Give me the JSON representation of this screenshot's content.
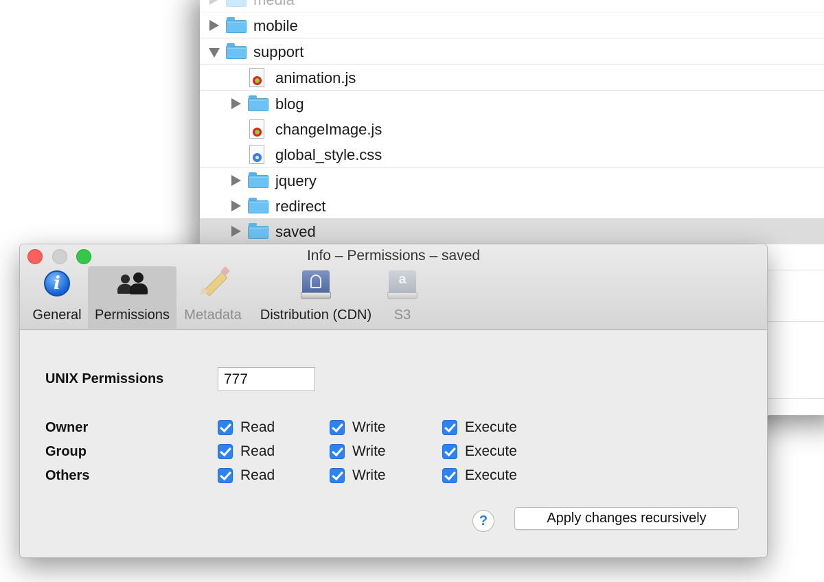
{
  "browser": {
    "rows": [
      {
        "label": "media",
        "kind": "folder",
        "expanded": false,
        "depth": 0,
        "faded": true
      },
      {
        "label": "mobile",
        "kind": "folder",
        "expanded": false,
        "depth": 0
      },
      {
        "label": "support",
        "kind": "folder",
        "expanded": true,
        "depth": 0
      },
      {
        "label": "animation.js",
        "kind": "js-file",
        "depth": 1
      },
      {
        "label": "blog",
        "kind": "folder",
        "expanded": false,
        "depth": 1
      },
      {
        "label": "changeImage.js",
        "kind": "js-file",
        "depth": 1
      },
      {
        "label": "global_style.css",
        "kind": "css-file",
        "depth": 1
      },
      {
        "label": "jquery",
        "kind": "folder",
        "expanded": false,
        "depth": 1
      },
      {
        "label": "redirect",
        "kind": "folder",
        "expanded": false,
        "depth": 1
      },
      {
        "label": "saved",
        "kind": "folder",
        "expanded": false,
        "depth": 1,
        "selected": true
      }
    ]
  },
  "dialog": {
    "title": "Info – Permissions – saved",
    "tabs": [
      {
        "label": "General",
        "icon": "info-icon",
        "active": false,
        "enabled": true
      },
      {
        "label": "Permissions",
        "icon": "people-icon",
        "active": true,
        "enabled": true
      },
      {
        "label": "Metadata",
        "icon": "pencil-icon",
        "active": false,
        "enabled": false
      },
      {
        "label": "Distribution (CDN)",
        "icon": "drive-icon",
        "active": false,
        "enabled": true
      },
      {
        "label": "S3",
        "icon": "amazon-s3-icon",
        "active": false,
        "enabled": false
      }
    ],
    "unix_label": "UNIX Permissions",
    "unix_value": "777",
    "permission_rows": [
      {
        "label": "Owner",
        "read": true,
        "write": true,
        "execute": true
      },
      {
        "label": "Group",
        "read": true,
        "write": true,
        "execute": true
      },
      {
        "label": "Others",
        "read": true,
        "write": true,
        "execute": true
      }
    ],
    "col_labels": {
      "read": "Read",
      "write": "Write",
      "execute": "Execute"
    },
    "help_label": "?",
    "apply_label": "Apply changes recursively"
  },
  "colors": {
    "accent": "#2b83f6",
    "close": "#fc605c",
    "maximize": "#34c84a",
    "folder": "#6cc2f2"
  }
}
